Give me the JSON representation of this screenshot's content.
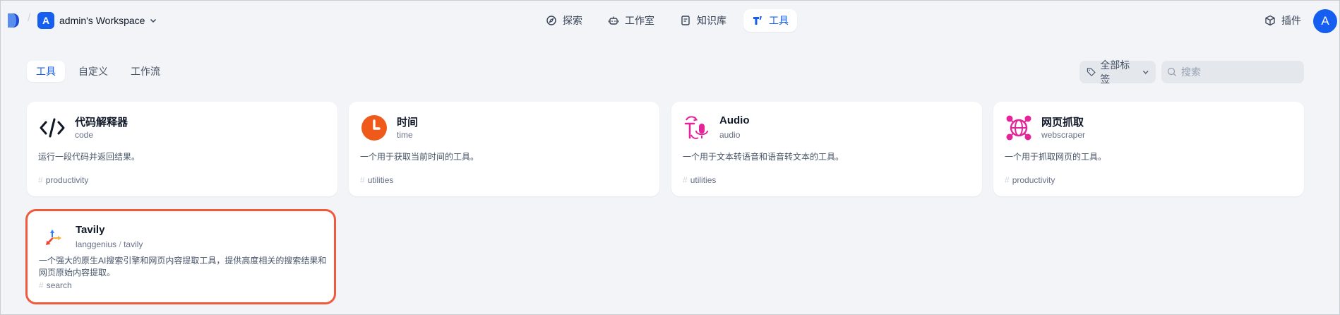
{
  "header": {
    "workspace_initial": "A",
    "workspace_name": "admin's Workspace",
    "nav": [
      {
        "label": "探索",
        "icon": "compass-icon"
      },
      {
        "label": "工作室",
        "icon": "robot-icon"
      },
      {
        "label": "知识库",
        "icon": "book-icon"
      },
      {
        "label": "工具",
        "icon": "tool-icon",
        "active": true
      }
    ],
    "plugins_label": "插件",
    "user_initial": "A"
  },
  "tabs": [
    {
      "label": "工具",
      "active": true
    },
    {
      "label": "自定义"
    },
    {
      "label": "工作流"
    }
  ],
  "filter": {
    "tag_label": "全部标签",
    "search_placeholder": "搜索"
  },
  "tools": [
    {
      "title": "代码解释器",
      "subtitle": "code",
      "description": "运行一段代码并返回结果。",
      "tag": "productivity",
      "icon": "code-icon"
    },
    {
      "title": "时间",
      "subtitle": "time",
      "description": "一个用于获取当前时间的工具。",
      "tag": "utilities",
      "icon": "clock-icon"
    },
    {
      "title": "Audio",
      "subtitle": "audio",
      "description": "一个用于文本转语音和语音转文本的工具。",
      "tag": "utilities",
      "icon": "audio-icon"
    },
    {
      "title": "网页抓取",
      "subtitle": "webscraper",
      "description": "一个用于抓取网页的工具。",
      "tag": "productivity",
      "icon": "globe-icon"
    },
    {
      "title": "Tavily",
      "subtitle_author": "langgenius",
      "subtitle_sep": "/",
      "subtitle_name": "tavily",
      "description": "一个强大的原生AI搜索引擎和网页内容提取工具，提供高度相关的搜索结果和网页原始内容提取。",
      "tag": "search",
      "icon": "tavily-icon"
    }
  ],
  "colors": {
    "accent": "#155eef",
    "highlight_border": "#ef5a3c",
    "clock_orange": "#ef5a1a",
    "pink": "#e5249a"
  }
}
